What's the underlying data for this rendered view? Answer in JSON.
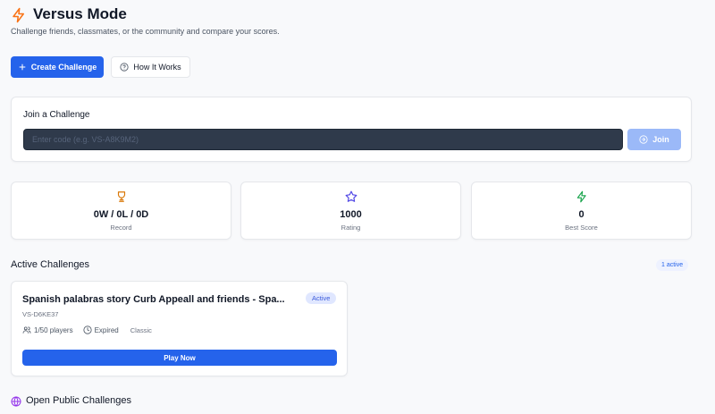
{
  "header": {
    "icon": "lightning-icon",
    "title": "Versus Mode",
    "subtitle": "Challenge friends, classmates, or the community and compare your scores."
  },
  "actions": {
    "create_label": "Create Challenge",
    "how_label": "How It Works"
  },
  "join": {
    "title": "Join a Challenge",
    "placeholder": "Enter code (e.g. VS-A8K9M2)",
    "button_label": "Join"
  },
  "stats": [
    {
      "icon": "trophy-icon",
      "value": "0W / 0L / 0D",
      "label": "Record"
    },
    {
      "icon": "star-icon",
      "value": "1000",
      "label": "Rating"
    },
    {
      "icon": "lightning-icon",
      "value": "0",
      "label": "Best Score"
    }
  ],
  "active_section": {
    "title": "Active Challenges",
    "count_badge": "1 active"
  },
  "challenges": [
    {
      "title": "Spanish palabras story Curb Appeall and friends - Spa...",
      "status": "Active",
      "code": "VS-D6KE37",
      "players": "1/50 players",
      "expiry": "Expired",
      "type": "Classic",
      "play_label": "Play Now"
    }
  ],
  "open_section": {
    "title": "Open Public Challenges"
  },
  "colors": {
    "primary": "#2563eb",
    "accent_orange": "#f97316",
    "trophy": "#d97706",
    "star": "#4f46e5",
    "bolt_green": "#16a34a",
    "globe": "#9333ea"
  }
}
